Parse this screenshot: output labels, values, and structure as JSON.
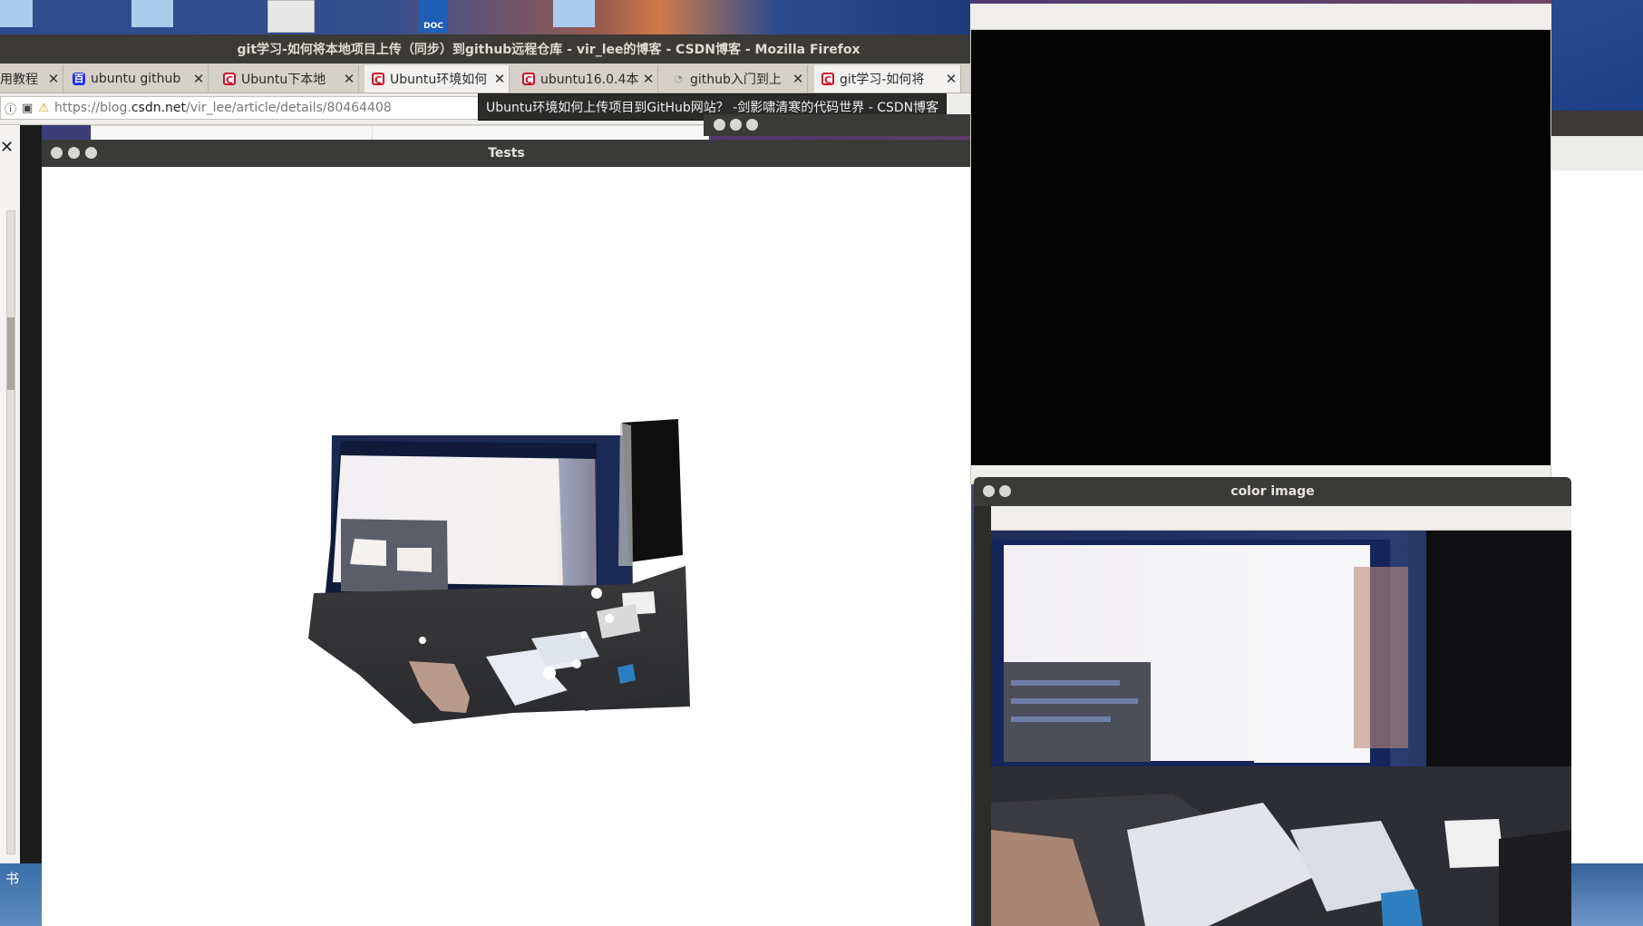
{
  "firefox": {
    "window_title": "git学习-如何将本地项目上传（同步）到github远程仓库 - vir_lee的博客 - CSDN博客 - Mozilla Firefox",
    "tabs": [
      {
        "label": "用教程",
        "favicon": "generic-icon",
        "active": false
      },
      {
        "label": "ubuntu github",
        "favicon": "baidu-icon",
        "active": false
      },
      {
        "label": "Ubuntu下本地",
        "favicon": "csdn-icon",
        "active": false
      },
      {
        "label": "Ubuntu环境如何",
        "favicon": "csdn-icon",
        "active": true
      },
      {
        "label": "ubuntu16.0.4本",
        "favicon": "csdn-icon",
        "active": false
      },
      {
        "label": "github入门到上",
        "favicon": "github-icon",
        "active": false
      },
      {
        "label": "git学习-如何将",
        "favicon": "csdn-icon",
        "active": true
      }
    ],
    "url": {
      "prefix": "https://blog.",
      "host": "csdn.net",
      "path": "/vir_lee/article/details/80464408"
    },
    "tooltip": "Ubuntu环境如何上传项目到GitHub网站？ -剑影啸清寒的代码世界 - CSDN博客"
  },
  "desktop": {
    "doc_icon_label": "DOC",
    "bottom_left_char": "书"
  },
  "windows": {
    "tests": {
      "title": "Tests"
    },
    "color_image": {
      "title": "color image"
    }
  }
}
